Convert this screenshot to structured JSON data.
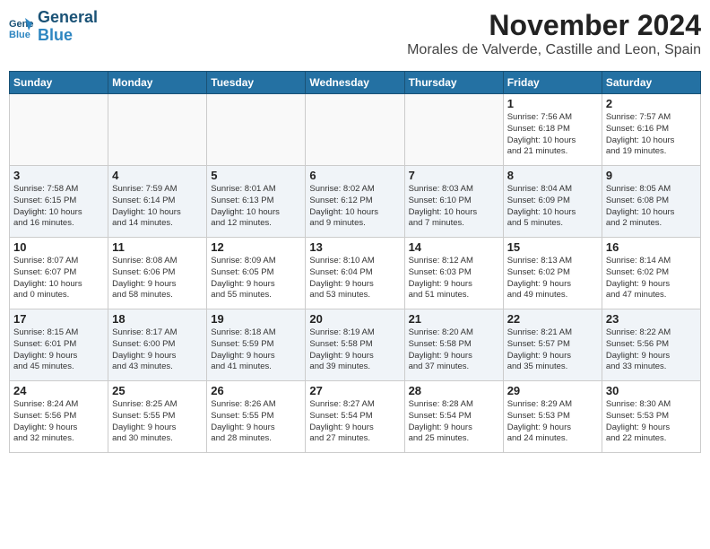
{
  "logo": {
    "line1": "General",
    "line2": "Blue"
  },
  "title": "November 2024",
  "location": "Morales de Valverde, Castille and Leon, Spain",
  "weekdays": [
    "Sunday",
    "Monday",
    "Tuesday",
    "Wednesday",
    "Thursday",
    "Friday",
    "Saturday"
  ],
  "weeks": [
    [
      {
        "day": "",
        "info": ""
      },
      {
        "day": "",
        "info": ""
      },
      {
        "day": "",
        "info": ""
      },
      {
        "day": "",
        "info": ""
      },
      {
        "day": "",
        "info": ""
      },
      {
        "day": "1",
        "info": "Sunrise: 7:56 AM\nSunset: 6:18 PM\nDaylight: 10 hours\nand 21 minutes."
      },
      {
        "day": "2",
        "info": "Sunrise: 7:57 AM\nSunset: 6:16 PM\nDaylight: 10 hours\nand 19 minutes."
      }
    ],
    [
      {
        "day": "3",
        "info": "Sunrise: 7:58 AM\nSunset: 6:15 PM\nDaylight: 10 hours\nand 16 minutes."
      },
      {
        "day": "4",
        "info": "Sunrise: 7:59 AM\nSunset: 6:14 PM\nDaylight: 10 hours\nand 14 minutes."
      },
      {
        "day": "5",
        "info": "Sunrise: 8:01 AM\nSunset: 6:13 PM\nDaylight: 10 hours\nand 12 minutes."
      },
      {
        "day": "6",
        "info": "Sunrise: 8:02 AM\nSunset: 6:12 PM\nDaylight: 10 hours\nand 9 minutes."
      },
      {
        "day": "7",
        "info": "Sunrise: 8:03 AM\nSunset: 6:10 PM\nDaylight: 10 hours\nand 7 minutes."
      },
      {
        "day": "8",
        "info": "Sunrise: 8:04 AM\nSunset: 6:09 PM\nDaylight: 10 hours\nand 5 minutes."
      },
      {
        "day": "9",
        "info": "Sunrise: 8:05 AM\nSunset: 6:08 PM\nDaylight: 10 hours\nand 2 minutes."
      }
    ],
    [
      {
        "day": "10",
        "info": "Sunrise: 8:07 AM\nSunset: 6:07 PM\nDaylight: 10 hours\nand 0 minutes."
      },
      {
        "day": "11",
        "info": "Sunrise: 8:08 AM\nSunset: 6:06 PM\nDaylight: 9 hours\nand 58 minutes."
      },
      {
        "day": "12",
        "info": "Sunrise: 8:09 AM\nSunset: 6:05 PM\nDaylight: 9 hours\nand 55 minutes."
      },
      {
        "day": "13",
        "info": "Sunrise: 8:10 AM\nSunset: 6:04 PM\nDaylight: 9 hours\nand 53 minutes."
      },
      {
        "day": "14",
        "info": "Sunrise: 8:12 AM\nSunset: 6:03 PM\nDaylight: 9 hours\nand 51 minutes."
      },
      {
        "day": "15",
        "info": "Sunrise: 8:13 AM\nSunset: 6:02 PM\nDaylight: 9 hours\nand 49 minutes."
      },
      {
        "day": "16",
        "info": "Sunrise: 8:14 AM\nSunset: 6:02 PM\nDaylight: 9 hours\nand 47 minutes."
      }
    ],
    [
      {
        "day": "17",
        "info": "Sunrise: 8:15 AM\nSunset: 6:01 PM\nDaylight: 9 hours\nand 45 minutes."
      },
      {
        "day": "18",
        "info": "Sunrise: 8:17 AM\nSunset: 6:00 PM\nDaylight: 9 hours\nand 43 minutes."
      },
      {
        "day": "19",
        "info": "Sunrise: 8:18 AM\nSunset: 5:59 PM\nDaylight: 9 hours\nand 41 minutes."
      },
      {
        "day": "20",
        "info": "Sunrise: 8:19 AM\nSunset: 5:58 PM\nDaylight: 9 hours\nand 39 minutes."
      },
      {
        "day": "21",
        "info": "Sunrise: 8:20 AM\nSunset: 5:58 PM\nDaylight: 9 hours\nand 37 minutes."
      },
      {
        "day": "22",
        "info": "Sunrise: 8:21 AM\nSunset: 5:57 PM\nDaylight: 9 hours\nand 35 minutes."
      },
      {
        "day": "23",
        "info": "Sunrise: 8:22 AM\nSunset: 5:56 PM\nDaylight: 9 hours\nand 33 minutes."
      }
    ],
    [
      {
        "day": "24",
        "info": "Sunrise: 8:24 AM\nSunset: 5:56 PM\nDaylight: 9 hours\nand 32 minutes."
      },
      {
        "day": "25",
        "info": "Sunrise: 8:25 AM\nSunset: 5:55 PM\nDaylight: 9 hours\nand 30 minutes."
      },
      {
        "day": "26",
        "info": "Sunrise: 8:26 AM\nSunset: 5:55 PM\nDaylight: 9 hours\nand 28 minutes."
      },
      {
        "day": "27",
        "info": "Sunrise: 8:27 AM\nSunset: 5:54 PM\nDaylight: 9 hours\nand 27 minutes."
      },
      {
        "day": "28",
        "info": "Sunrise: 8:28 AM\nSunset: 5:54 PM\nDaylight: 9 hours\nand 25 minutes."
      },
      {
        "day": "29",
        "info": "Sunrise: 8:29 AM\nSunset: 5:53 PM\nDaylight: 9 hours\nand 24 minutes."
      },
      {
        "day": "30",
        "info": "Sunrise: 8:30 AM\nSunset: 5:53 PM\nDaylight: 9 hours\nand 22 minutes."
      }
    ]
  ]
}
